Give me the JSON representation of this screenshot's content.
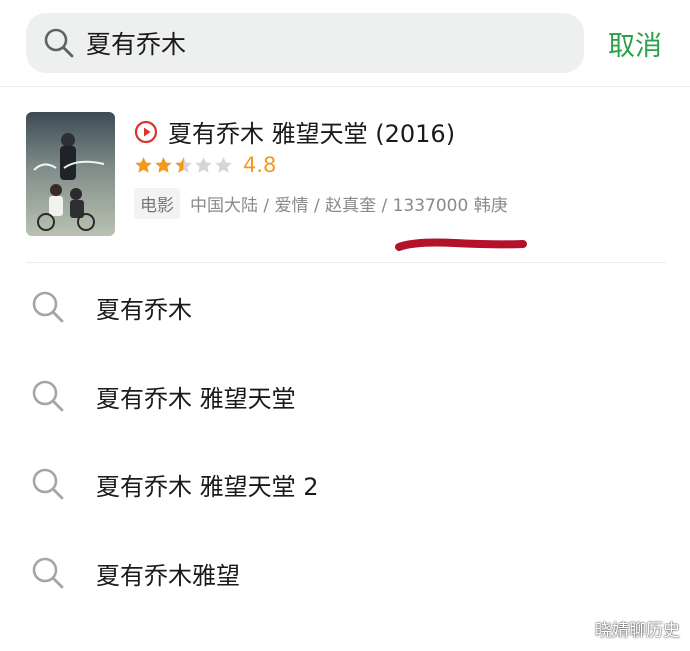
{
  "search": {
    "query": "夏有乔木",
    "cancel_label": "取消"
  },
  "result": {
    "title": "夏有乔木 雅望天堂 (2016)",
    "rating_stars": 2.5,
    "rating_max": 5,
    "score": "4.8",
    "type_tag": "电影",
    "meta": "中国大陆 / 爱情 / 赵真奎 / 1337000 韩庚"
  },
  "suggestions": [
    {
      "label": "夏有乔木"
    },
    {
      "label": "夏有乔木 雅望天堂"
    },
    {
      "label": "夏有乔木 雅望天堂 2"
    },
    {
      "label": "夏有乔木雅望"
    }
  ],
  "watermark": "晓婧聊历史",
  "colors": {
    "accent_green": "#2aa14a",
    "star_orange": "#f29a1e",
    "play_red": "#e0322d",
    "scribble_red": "#b3122a"
  },
  "icons": {
    "search": "search-icon",
    "play": "play-circle-icon",
    "star": "star-icon"
  }
}
